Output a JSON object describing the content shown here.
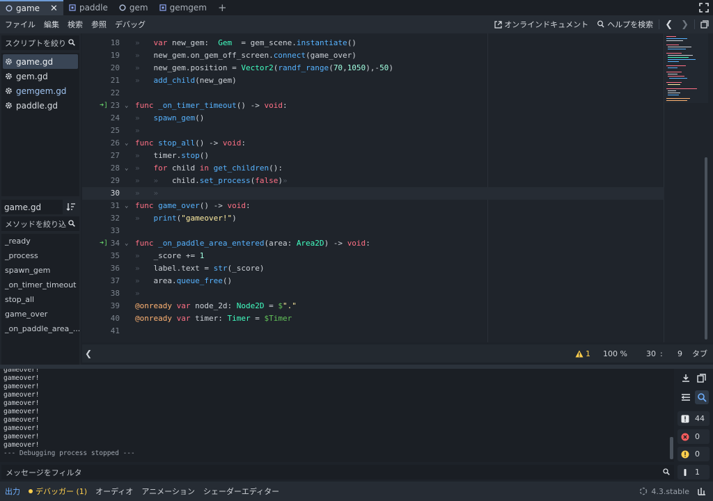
{
  "tabs": [
    {
      "label": "game",
      "active": true,
      "icon": "circle-script-icon"
    },
    {
      "label": "paddle",
      "active": false,
      "icon": "node2d-icon"
    },
    {
      "label": "gem",
      "active": false,
      "icon": "circle-script-icon"
    },
    {
      "label": "gemgem",
      "active": false,
      "icon": "node2d-icon"
    }
  ],
  "menu": [
    "ファイル",
    "編集",
    "検索",
    "参照",
    "デバッグ"
  ],
  "toolbar": {
    "online_docs": "オンラインドキュメント",
    "search_help": "ヘルプを検索"
  },
  "left": {
    "script_filter_placeholder": "スクリプトを絞り",
    "scripts": [
      "game.gd",
      "gem.gd",
      "gemgem.gd",
      "paddle.gd"
    ],
    "selected_script": "game.gd",
    "current_file": "game.gd",
    "method_filter_placeholder": "メソッドを絞り込",
    "methods": [
      "_ready",
      "_process",
      "spawn_gem",
      "_on_timer_timeout",
      "stop_all",
      "game_over",
      "_on_paddle_area_..."
    ]
  },
  "editor": {
    "current_line": 30
  },
  "status": {
    "warnings": "1",
    "zoom": "100 %",
    "line": "30",
    "colon": ":",
    "col": "9",
    "indent": "タブ"
  },
  "output": {
    "lines": [
      "gameover!",
      "gameover!",
      "gameover!",
      "gameover!",
      "gameover!",
      "gameover!",
      "gameover!",
      "gameover!",
      "gameover!",
      "gameover!"
    ],
    "last_line": "--- Debugging process stopped ---",
    "filter_placeholder": "メッセージをフィルタ",
    "counts": {
      "messages": "44",
      "errors": "0",
      "warnings": "0",
      "editor": "1"
    }
  },
  "bottom": {
    "output": "出力",
    "debugger": "デバッガー (1)",
    "audio": "オーディオ",
    "animation": "アニメーション",
    "shader": "シェーダーエディター",
    "version": "4.3.stable"
  },
  "colors": {
    "accent": "#6fb0ff",
    "keyword": "#ff7085",
    "function": "#57b3ff",
    "type": "#42ffc2",
    "string": "#ffeda1",
    "annotation": "#ffb373"
  }
}
